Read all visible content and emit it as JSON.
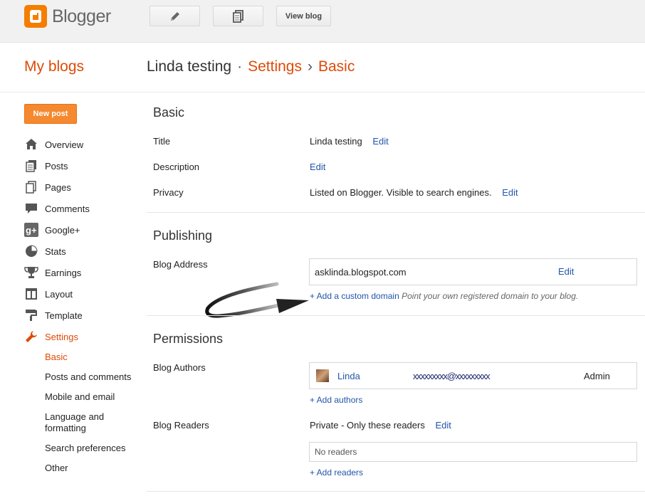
{
  "topbar": {
    "logo_text": "Blogger",
    "view_blog_label": "View blog"
  },
  "header": {
    "my_blogs": "My blogs",
    "blog_name": "Linda testing",
    "dot": "·",
    "settings": "Settings",
    "chevron": "›",
    "page": "Basic"
  },
  "sidebar": {
    "new_post_label": "New post",
    "items": [
      {
        "label": "Overview",
        "icon": "home-icon"
      },
      {
        "label": "Posts",
        "icon": "posts-icon"
      },
      {
        "label": "Pages",
        "icon": "pages-icon"
      },
      {
        "label": "Comments",
        "icon": "comments-icon"
      },
      {
        "label": "Google+",
        "icon": "google-plus-icon"
      },
      {
        "label": "Stats",
        "icon": "stats-icon"
      },
      {
        "label": "Earnings",
        "icon": "trophy-icon"
      },
      {
        "label": "Layout",
        "icon": "layout-icon"
      },
      {
        "label": "Template",
        "icon": "template-icon"
      },
      {
        "label": "Settings",
        "icon": "wrench-icon"
      }
    ],
    "sub_items": [
      "Basic",
      "Posts and comments",
      "Mobile and email",
      "Language and formatting",
      "Search preferences",
      "Other"
    ]
  },
  "basic": {
    "section_title": "Basic",
    "title_label": "Title",
    "title_value": "Linda testing",
    "description_label": "Description",
    "privacy_label": "Privacy",
    "privacy_value": "Listed on Blogger. Visible to search engines.",
    "edit": "Edit"
  },
  "publishing": {
    "section_title": "Publishing",
    "blog_address_label": "Blog Address",
    "address": "asklinda.blogspot.com",
    "edit": "Edit",
    "custom_domain_link": "+ Add a custom domain",
    "custom_domain_hint": "Point your own registered domain to your blog."
  },
  "permissions": {
    "section_title": "Permissions",
    "blog_authors_label": "Blog Authors",
    "author_name": "Linda",
    "author_email": "xxxxxxxxx@xxxxxxxxx",
    "author_role": "Admin",
    "add_authors": "+ Add authors",
    "blog_readers_label": "Blog Readers",
    "readers_value": "Private - Only these readers",
    "edit": "Edit",
    "no_readers": "No readers",
    "add_readers": "+ Add readers"
  },
  "colors": {
    "accent": "#dd4b07",
    "link": "#2255aa",
    "new_post_bg": "#f5892f"
  }
}
